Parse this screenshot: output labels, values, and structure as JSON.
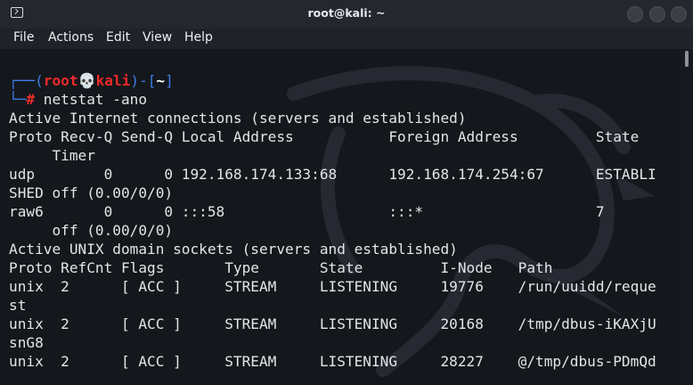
{
  "window": {
    "title": "root@kali: ~"
  },
  "menu": {
    "items": [
      "File",
      "Actions",
      "Edit",
      "View",
      "Help"
    ]
  },
  "prompt": {
    "corner_top": "┌──(",
    "user": "root",
    "skull": "💀",
    "host": "kali",
    "sep": ")-[",
    "dir": "~",
    "close": "]",
    "corner_bottom": "└─",
    "hash": "#",
    "command": " netstat -ano"
  },
  "output": [
    "Active Internet connections (servers and established)",
    "Proto Recv-Q Send-Q Local Address           Foreign Address         State",
    "     Timer",
    "udp        0      0 192.168.174.133:68      192.168.174.254:67      ESTABLI",
    "SHED off (0.00/0/0)",
    "raw6       0      0 :::58                   :::*                    7",
    "     off (0.00/0/0)",
    "Active UNIX domain sockets (servers and established)",
    "Proto RefCnt Flags       Type       State         I-Node   Path",
    "unix  2      [ ACC ]     STREAM     LISTENING     19776    /run/uuidd/reque",
    "st",
    "unix  2      [ ACC ]     STREAM     LISTENING     20168    /tmp/dbus-iKAXjU",
    "snG8",
    "unix  2      [ ACC ]     STREAM     LISTENING     28227    @/tmp/dbus-PDmQd"
  ],
  "colors": {
    "background": "#14171c",
    "text": "#e3e5e8",
    "prompt_blue": "#3d7ee8",
    "prompt_red": "#ee2a2a"
  },
  "icons": {
    "app": "terminal-icon",
    "window_buttons": [
      "minimize-button",
      "maximize-button",
      "close-button"
    ]
  }
}
